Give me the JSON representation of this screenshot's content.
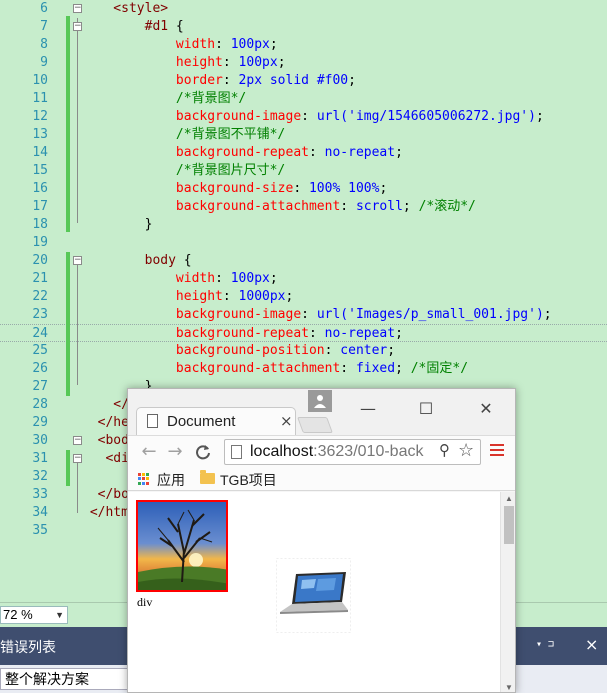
{
  "editor": {
    "lines": [
      {
        "n": "6",
        "tokens": [
          [
            "tag",
            "    <style>"
          ]
        ]
      },
      {
        "n": "7",
        "tokens": [
          [
            "sel",
            "        #d1 "
          ],
          [
            "punc",
            "{"
          ]
        ]
      },
      {
        "n": "8",
        "tokens": [
          [
            "prop",
            "            width"
          ],
          [
            "punc",
            ": "
          ],
          [
            "val",
            "100px"
          ],
          [
            "punc",
            ";"
          ]
        ]
      },
      {
        "n": "9",
        "tokens": [
          [
            "prop",
            "            height"
          ],
          [
            "punc",
            ": "
          ],
          [
            "val",
            "100px"
          ],
          [
            "punc",
            ";"
          ]
        ]
      },
      {
        "n": "10",
        "tokens": [
          [
            "prop",
            "            border"
          ],
          [
            "punc",
            ": "
          ],
          [
            "val",
            "2px solid #f00"
          ],
          [
            "punc",
            ";"
          ]
        ]
      },
      {
        "n": "11",
        "tokens": [
          [
            "cmt",
            "            /*背景图*/"
          ]
        ]
      },
      {
        "n": "12",
        "tokens": [
          [
            "prop",
            "            background-image"
          ],
          [
            "punc",
            ": "
          ],
          [
            "val",
            "url('img/1546605006272.jpg')"
          ],
          [
            "punc",
            ";"
          ]
        ]
      },
      {
        "n": "13",
        "tokens": [
          [
            "cmt",
            "            /*背景图不平铺*/"
          ]
        ]
      },
      {
        "n": "14",
        "tokens": [
          [
            "prop",
            "            background-repeat"
          ],
          [
            "punc",
            ": "
          ],
          [
            "val",
            "no-repeat"
          ],
          [
            "punc",
            ";"
          ]
        ]
      },
      {
        "n": "15",
        "tokens": [
          [
            "cmt",
            "            /*背景图片尺寸*/"
          ]
        ]
      },
      {
        "n": "16",
        "tokens": [
          [
            "prop",
            "            background-size"
          ],
          [
            "punc",
            ": "
          ],
          [
            "val",
            "100% 100%"
          ],
          [
            "punc",
            ";"
          ]
        ]
      },
      {
        "n": "17",
        "tokens": [
          [
            "prop",
            "            background-attachment"
          ],
          [
            "punc",
            ": "
          ],
          [
            "val",
            "scroll"
          ],
          [
            "punc",
            "; "
          ],
          [
            "cmt",
            "/*滚动*/"
          ]
        ]
      },
      {
        "n": "18",
        "tokens": [
          [
            "punc",
            "        }"
          ]
        ]
      },
      {
        "n": "19",
        "tokens": []
      },
      {
        "n": "20",
        "tokens": [
          [
            "sel",
            "        body "
          ],
          [
            "punc",
            "{"
          ]
        ]
      },
      {
        "n": "21",
        "tokens": [
          [
            "prop",
            "            width"
          ],
          [
            "punc",
            ": "
          ],
          [
            "val",
            "100px"
          ],
          [
            "punc",
            ";"
          ]
        ]
      },
      {
        "n": "22",
        "tokens": [
          [
            "prop",
            "            height"
          ],
          [
            "punc",
            ": "
          ],
          [
            "val",
            "1000px"
          ],
          [
            "punc",
            ";"
          ]
        ]
      },
      {
        "n": "23",
        "tokens": [
          [
            "prop",
            "            background-image"
          ],
          [
            "punc",
            ": "
          ],
          [
            "val",
            "url('Images/p_small_001.jpg')"
          ],
          [
            "punc",
            ";"
          ]
        ]
      },
      {
        "n": "24",
        "tokens": [
          [
            "prop",
            "            background-repeat"
          ],
          [
            "punc",
            ": "
          ],
          [
            "val",
            "no-repeat"
          ],
          [
            "punc",
            ";"
          ]
        ]
      },
      {
        "n": "25",
        "tokens": [
          [
            "prop",
            "            background-position"
          ],
          [
            "punc",
            ": "
          ],
          [
            "val",
            "center"
          ],
          [
            "punc",
            ";"
          ]
        ]
      },
      {
        "n": "26",
        "tokens": [
          [
            "prop",
            "            background-attachment"
          ],
          [
            "punc",
            ": "
          ],
          [
            "val",
            "fixed"
          ],
          [
            "punc",
            "; "
          ],
          [
            "cmt",
            "/*固定*/"
          ]
        ]
      },
      {
        "n": "27",
        "tokens": [
          [
            "punc",
            "        }"
          ]
        ]
      },
      {
        "n": "28",
        "tokens": [
          [
            "tag",
            "    </"
          ]
        ]
      },
      {
        "n": "29",
        "tokens": [
          [
            "tag",
            "  </hea"
          ]
        ]
      },
      {
        "n": "30",
        "tokens": [
          [
            "tag",
            "  <body"
          ]
        ]
      },
      {
        "n": "31",
        "tokens": [
          [
            "tag",
            "   <div"
          ]
        ]
      },
      {
        "n": "32",
        "tokens": [
          [
            "punc",
            "      d"
          ]
        ]
      },
      {
        "n": "33",
        "tokens": [
          [
            "tag",
            "  </bod"
          ]
        ]
      },
      {
        "n": "34",
        "tokens": [
          [
            "tag",
            " </html"
          ]
        ]
      },
      {
        "n": "35",
        "tokens": []
      }
    ]
  },
  "status": {
    "zoom": "72 %"
  },
  "error_panel": {
    "title": "错误列表",
    "pin": "▾ ⊐",
    "close": "×",
    "scope": "整个解决方案"
  },
  "browser": {
    "tab_title": "Document",
    "tab_close": "×",
    "url_host": "localhost",
    "url_rest": ":3623/010-back",
    "bookmarks": {
      "apps_label": "应用",
      "folder_label": "TGB项目"
    },
    "page": {
      "div_text": "div"
    },
    "window_buttons": {
      "minimize": "—",
      "maximize": "☐",
      "close": "✕"
    },
    "nav": {
      "back": "←",
      "forward": "→",
      "reload": "C"
    },
    "apps_colors": [
      "#e94235",
      "#fbbc04",
      "#34a853",
      "#4285f4",
      "#e94235",
      "#fbbc04",
      "#34a853",
      "#4285f4",
      "#e94235"
    ]
  }
}
